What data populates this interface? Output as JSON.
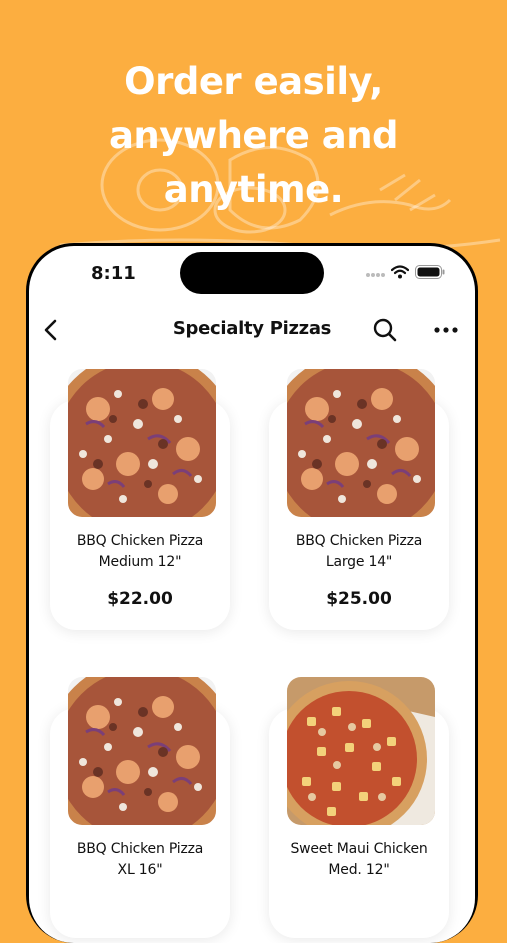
{
  "headline": {
    "line1": "Order easily,",
    "line2": "anywhere and",
    "line3": "anytime."
  },
  "status_bar": {
    "time": "8:11"
  },
  "nav": {
    "title": "Specialty Pizzas"
  },
  "products": [
    {
      "name_line1": "BBQ Chicken Pizza",
      "name_line2": "Medium 12\"",
      "price": "$22.00"
    },
    {
      "name_line1": "BBQ Chicken Pizza",
      "name_line2": "Large 14\"",
      "price": "$25.00"
    },
    {
      "name_line1": "BBQ Chicken Pizza",
      "name_line2": "XL 16\""
    },
    {
      "name_line1": "Sweet Maui Chicken",
      "name_line2": "Med. 12\""
    }
  ],
  "colors": {
    "background": "#FCAE40",
    "card": "#FFFFFF",
    "text": "#111111"
  },
  "icons": [
    "back-chevron-icon",
    "search-icon",
    "more-icon",
    "signal-icon",
    "wifi-icon",
    "battery-icon"
  ]
}
